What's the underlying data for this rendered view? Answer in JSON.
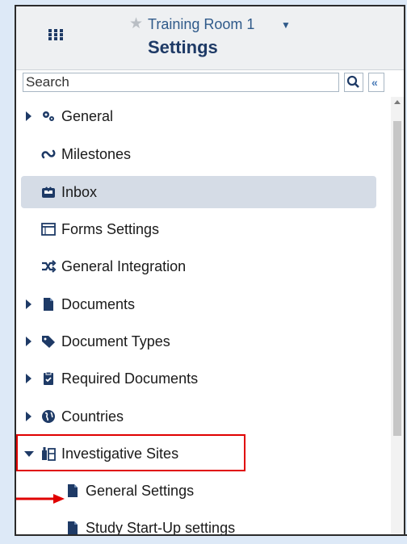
{
  "header": {
    "project_title": "Training Room 1",
    "page_title": "Settings",
    "icons": [
      "grid-icon",
      "star-icon",
      "caret-down-icon"
    ]
  },
  "search": {
    "placeholder": "Search",
    "value": ""
  },
  "nav": {
    "items": [
      {
        "label": "General",
        "icon": "gears-icon",
        "expandable": true,
        "expanded": false
      },
      {
        "label": "Milestones",
        "icon": "milestones-icon",
        "expandable": false
      },
      {
        "label": "Inbox",
        "icon": "inbox-icon",
        "expandable": false,
        "active": true
      },
      {
        "label": "Forms Settings",
        "icon": "forms-icon",
        "expandable": false
      },
      {
        "label": "General Integration",
        "icon": "shuffle-icon",
        "expandable": false
      },
      {
        "label": "Documents",
        "icon": "document-icon",
        "expandable": true,
        "expanded": false
      },
      {
        "label": "Document Types",
        "icon": "tag-icon",
        "expandable": true,
        "expanded": false
      },
      {
        "label": "Required Documents",
        "icon": "clipboard-icon",
        "expandable": true,
        "expanded": false
      },
      {
        "label": "Countries",
        "icon": "globe-icon",
        "expandable": true,
        "expanded": false
      },
      {
        "label": "Investigative Sites",
        "icon": "sites-icon",
        "expandable": true,
        "expanded": true
      },
      {
        "label": "General Settings",
        "icon": "document-icon",
        "child": true
      },
      {
        "label": "Study Start-Up settings",
        "icon": "document-icon",
        "child": true
      }
    ]
  },
  "annotations": {
    "highlight_color": "#e00000"
  }
}
